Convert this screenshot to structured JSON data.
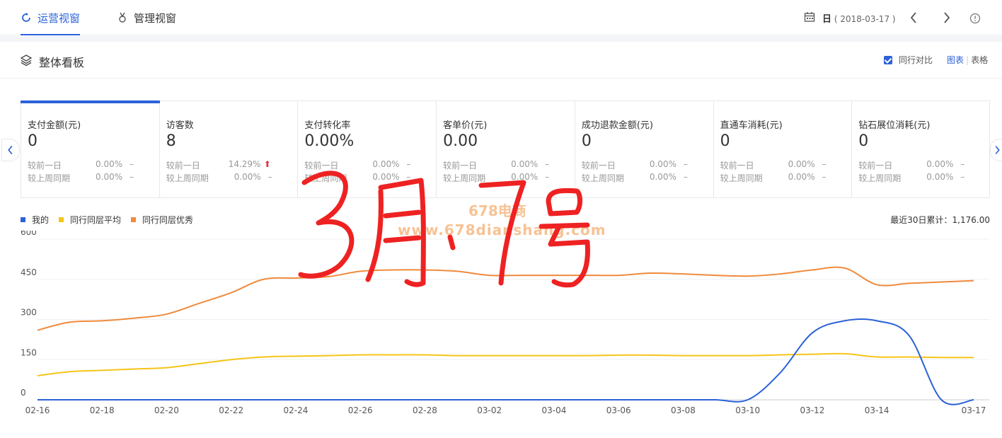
{
  "header": {
    "tabs": [
      {
        "label": "运营视窗",
        "active": true
      },
      {
        "label": "管理视窗",
        "active": false
      }
    ],
    "date_unit": "日",
    "date_value": "( 2018-03-17 )"
  },
  "section": {
    "title": "整体看板",
    "compare_label": "同行对比",
    "compare_checked": true,
    "view_chart": "图表",
    "view_table": "表格"
  },
  "cards": [
    {
      "label": "支付金额(元)",
      "value": "0",
      "day_label": "较前一日",
      "day_value": "0.00%",
      "day_trend": "–",
      "week_label": "较上周同期",
      "week_value": "0.00%",
      "week_trend": "–",
      "active": true
    },
    {
      "label": "访客数",
      "value": "8",
      "day_label": "较前一日",
      "day_value": "14.29%",
      "day_trend": "up",
      "week_label": "较上周同期",
      "week_value": "0.00%",
      "week_trend": "–",
      "active": false
    },
    {
      "label": "支付转化率",
      "value": "0.00%",
      "day_label": "较前一日",
      "day_value": "0.00%",
      "day_trend": "–",
      "week_label": "较上周同期",
      "week_value": "0.00%",
      "week_trend": "–",
      "active": false
    },
    {
      "label": "客单价(元)",
      "value": "0.00",
      "day_label": "较前一日",
      "day_value": "0.00%",
      "day_trend": "–",
      "week_label": "较上周同期",
      "week_value": "0.00%",
      "week_trend": "–",
      "active": false
    },
    {
      "label": "成功退款金额(元)",
      "value": "0",
      "day_label": "较前一日",
      "day_value": "0.00%",
      "day_trend": "–",
      "week_label": "较上周同期",
      "week_value": "0.00%",
      "week_trend": "–",
      "active": false
    },
    {
      "label": "直通车消耗(元)",
      "value": "0",
      "day_label": "较前一日",
      "day_value": "0.00%",
      "day_trend": "–",
      "week_label": "较上周同期",
      "week_value": "0.00%",
      "week_trend": "–",
      "active": false
    },
    {
      "label": "钻石展位消耗(元)",
      "value": "0",
      "day_label": "较前一日",
      "day_value": "0.00%",
      "day_trend": "–",
      "week_label": "较上周同期",
      "week_value": "0.00%",
      "week_trend": "–",
      "active": false
    }
  ],
  "chart_summary": "最近30日累计：1,176.00",
  "watermark": {
    "line1": "678电商",
    "line2": "www.678dianshang.com"
  },
  "handwriting": "3月17号",
  "colors": {
    "accent": "#2b62d9",
    "mine": "#2b62d9",
    "avg": "#f5c518",
    "excellent": "#f08a3c",
    "up": "#e0334a"
  },
  "chart_data": {
    "type": "line",
    "x": [
      "02-16",
      "02-17",
      "02-18",
      "02-19",
      "02-20",
      "02-21",
      "02-22",
      "02-23",
      "02-24",
      "02-25",
      "02-26",
      "02-27",
      "02-28",
      "03-01",
      "03-02",
      "03-03",
      "03-04",
      "03-05",
      "03-06",
      "03-07",
      "03-08",
      "03-09",
      "03-10",
      "03-11",
      "03-12",
      "03-13",
      "03-14",
      "03-15",
      "03-16",
      "03-17"
    ],
    "x_tick_labels": [
      "02-16",
      "02-18",
      "02-20",
      "02-22",
      "02-24",
      "02-26",
      "02-28",
      "03-02",
      "03-04",
      "03-06",
      "03-08",
      "03-10",
      "03-12",
      "03-14",
      "03-17"
    ],
    "ylim": [
      0,
      600
    ],
    "y_ticks": [
      0,
      150,
      300,
      450,
      600
    ],
    "grid": true,
    "legend_position": "top-left",
    "series": [
      {
        "name": "我的",
        "color": "#2b62d9",
        "values": [
          0,
          0,
          0,
          0,
          0,
          0,
          0,
          0,
          0,
          0,
          0,
          0,
          0,
          0,
          0,
          0,
          0,
          0,
          0,
          0,
          0,
          0,
          0,
          100,
          250,
          295,
          295,
          240,
          0,
          0
        ]
      },
      {
        "name": "同行同层平均",
        "color": "#f5c518",
        "values": [
          90,
          105,
          110,
          115,
          120,
          135,
          150,
          160,
          163,
          165,
          168,
          168,
          168,
          165,
          165,
          165,
          165,
          165,
          167,
          167,
          165,
          165,
          165,
          168,
          170,
          172,
          160,
          160,
          158,
          158
        ]
      },
      {
        "name": "同行同层优秀",
        "color": "#f08a3c",
        "values": [
          260,
          290,
          295,
          305,
          320,
          360,
          400,
          450,
          455,
          460,
          480,
          485,
          485,
          480,
          465,
          465,
          465,
          465,
          465,
          473,
          470,
          465,
          462,
          470,
          485,
          492,
          430,
          435,
          440,
          445
        ]
      }
    ]
  }
}
